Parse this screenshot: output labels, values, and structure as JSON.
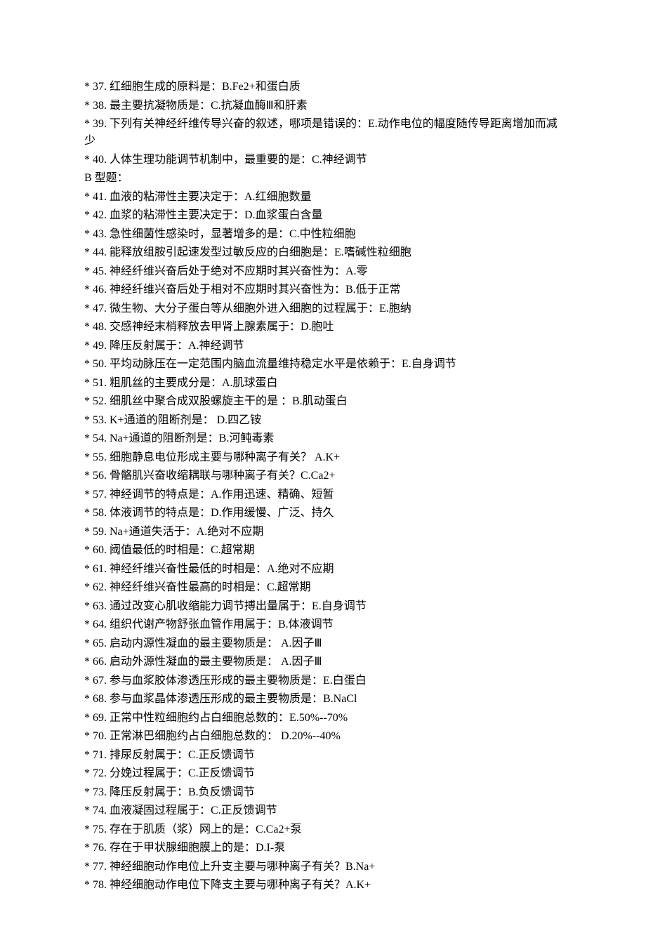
{
  "lines": [
    "* 37. 红细胞生成的原料是：B.Fe2+和蛋白质",
    "* 38. 最主要抗凝物质是：C.抗凝血酶Ⅲ和肝素",
    "* 39. 下列有关神经纤维传导兴奋的叙述，哪项是错误的：E.动作电位的幅度随传导距离增加而减少",
    "* 40. 人体生理功能调节机制中，最重要的是：C.神经调节",
    "B 型题：",
    "* 41. 血液的粘滞性主要决定于：A.红细胞数量",
    "* 42. 血浆的粘滞性主要决定于：D.血浆蛋白含量",
    "* 43. 急性细菌性感染时，显著增多的是：C.中性粒细胞",
    "* 44. 能释放组胺引起速发型过敏反应的白细胞是：E.嗜碱性粒细胞",
    "* 45. 神经纤维兴奋后处于绝对不应期时其兴奋性为：A.零",
    "* 46. 神经纤维兴奋后处于相对不应期时其兴奋性为：B.低于正常",
    "* 47. 微生物、大分子蛋白等从细胞外进入细胞的过程属于：E.胞纳",
    "* 48. 交感神经末梢释放去甲肾上腺素属于：D.胞吐",
    "* 49. 降压反射属于：A.神经调节",
    "* 50. 平均动脉压在一定范围内脑血流量维持稳定水平是依赖于：E.自身调节",
    "* 51. 粗肌丝的主要成分是：A.肌球蛋白",
    "* 52. 细肌丝中聚合成双股螺旋主干的是 ：B.肌动蛋白",
    "* 53. K+通道的阻断剂是：  D.四乙铵",
    "* 54. Na+通道的阻断剂是：B.河鲀毒素",
    "* 55. 细胞静息电位形成主要与哪种离子有关？  A.K+",
    "* 56. 骨骼肌兴奋收缩耦联与哪种离子有关？C.Ca2+",
    "* 57. 神经调节的特点是：A.作用迅速、精确、短暂",
    "* 58. 体液调节的特点是：D.作用缓慢、广泛、持久",
    "* 59. Na+通道失活于：A.绝对不应期",
    "* 60. 阈值最低的时相是：C.超常期",
    "* 61. 神经纤维兴奋性最低的时相是：A.绝对不应期",
    "* 62. 神经纤维兴奋性最高的时相是：C.超常期",
    "* 63. 通过改变心肌收缩能力调节搏出量属于：E.自身调节",
    "* 64. 组织代谢产物舒张血管作用属于：B.体液调节",
    "* 65. 启动内源性凝血的最主要物质是：  A.因子Ⅲ",
    "* 66. 启动外源性凝血的最主要物质是：  A.因子Ⅲ",
    "* 67. 参与血浆胶体渗透压形成的最主要物质是：E.白蛋白",
    "* 68. 参与血浆晶体渗透压形成的最主要物质是：B.NaCl",
    "* 69. 正常中性粒细胞约占白细胞总数的：E.50%--70%",
    "* 70. 正常淋巴细胞约占白细胞总数的：  D.20%--40%",
    "* 71. 排尿反射属于：C.正反馈调节",
    "* 72. 分娩过程属于：C.正反馈调节",
    "* 73. 降压反射属于：B.负反馈调节",
    "* 74. 血液凝固过程属于：C.正反馈调节",
    "* 75. 存在于肌质（浆）网上的是：C.Ca2+泵",
    "* 76. 存在于甲状腺细胞膜上的是：D.I-泵",
    "* 77. 神经细胞动作电位上升支主要与哪种离子有关？B.Na+",
    "* 78. 神经细胞动作电位下降支主要与哪种离子有关？A.K+"
  ]
}
